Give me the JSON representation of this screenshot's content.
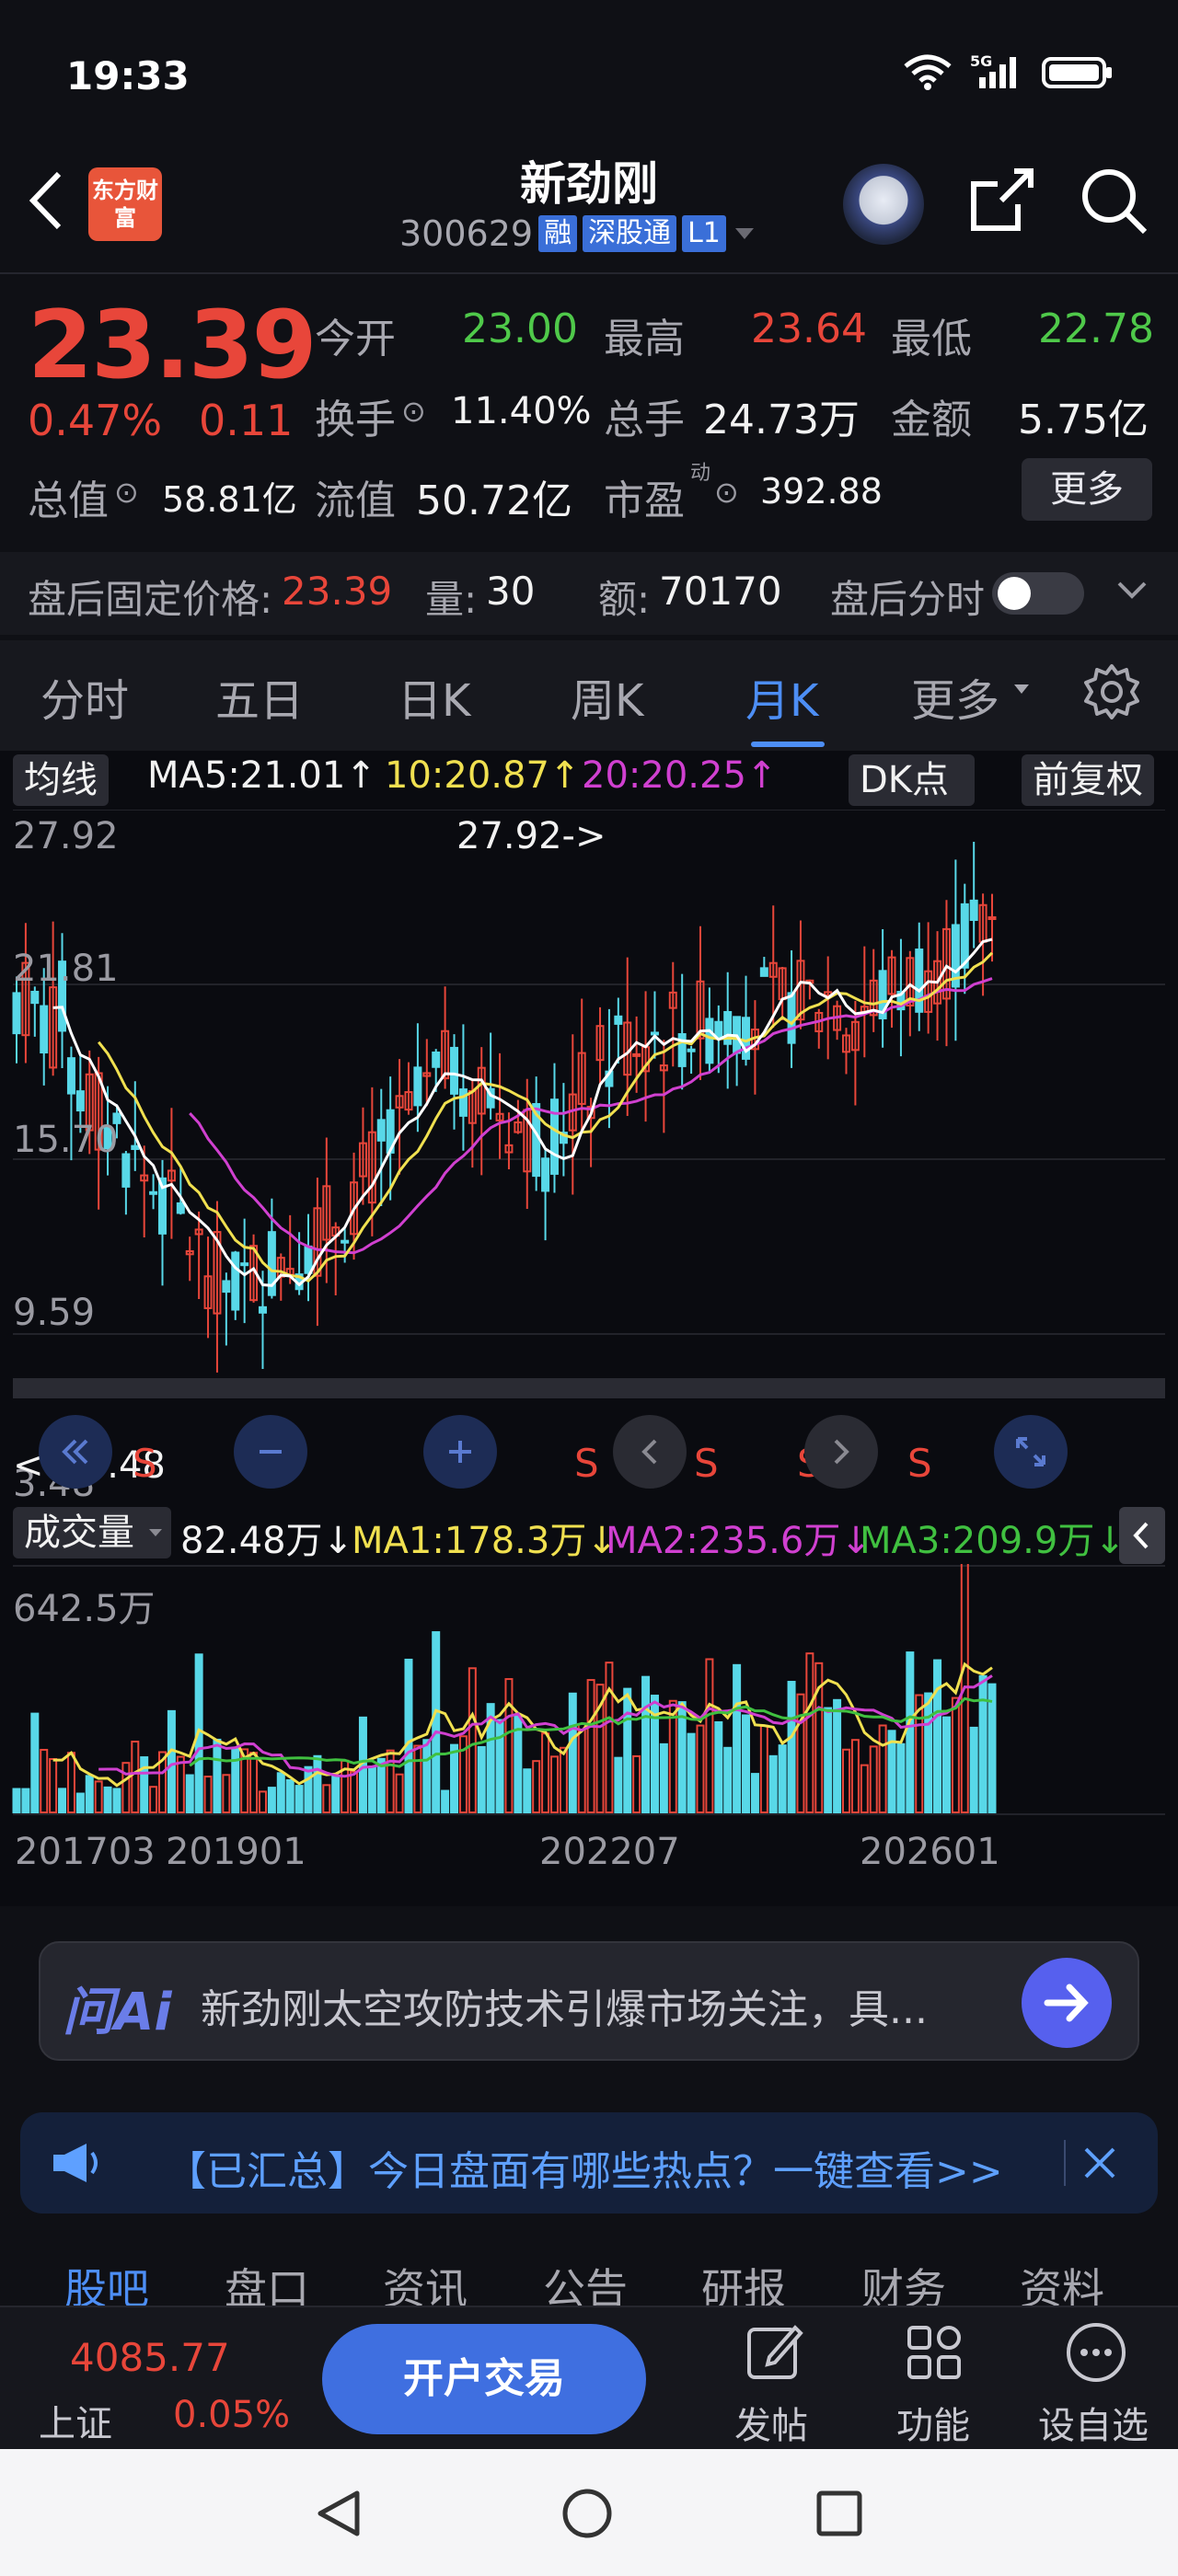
{
  "status": {
    "time": "19:33",
    "network": "5G"
  },
  "header": {
    "title": "新劲刚",
    "code": "300629",
    "tags": [
      "融",
      "深股通",
      "L1"
    ],
    "logo": "东方财富"
  },
  "quote": {
    "price": "23.39",
    "change_pct": "0.47%",
    "change": "0.11",
    "open_label": "今开",
    "open": "23.00",
    "high_label": "最高",
    "high": "23.64",
    "low_label": "最低",
    "low": "22.78",
    "turnover_label": "换手",
    "turnover": "11.40%",
    "volume_label": "总手",
    "volume": "24.73万",
    "amount_label": "金额",
    "amount": "5.75亿",
    "mcap_label": "总值",
    "mcap": "58.81亿",
    "float_label": "流值",
    "float": "50.72亿",
    "pe_label": "市盈",
    "pe_sup": "动",
    "pe": "392.88",
    "more": "更多"
  },
  "after_hours": {
    "price_label": "盘后固定价格:",
    "price": "23.39",
    "vol_label": "量:",
    "vol": "30",
    "amt_label": "额:",
    "amt": "70170",
    "tick_label": "盘后分时"
  },
  "tabs": [
    "分时",
    "五日",
    "日K",
    "周K",
    "月K",
    "更多"
  ],
  "active_tab": "月K",
  "kline": {
    "ma_btn": "均线",
    "ma5": "MA5:21.01↑",
    "ma10": "10:20.87↑",
    "ma20": "20:20.25↑",
    "dk_btn": "DK点",
    "fq_btn": "前复权",
    "y_top": "27.92",
    "y2": "21.81",
    "y3": "15.70",
    "y4": "9.59",
    "y_bottom": "3.48",
    "max_label": "27.92->",
    "min_label": "<---3.48",
    "s_marker": "S",
    "colors": {
      "up": "#e8463a",
      "down": "#58d8e8",
      "ma5": "#ffffff",
      "ma10": "#f0e050",
      "ma20": "#d040d0",
      "ma3": "#40c040"
    }
  },
  "volume": {
    "btn": "成交量",
    "value": "82.48万↓",
    "ma1": "MA1:178.3万↓",
    "ma2": "MA2:235.6万↓",
    "ma3": "MA3:209.9万↓",
    "y_top": "642.5万",
    "x_labels": [
      "201703",
      "201901",
      "202207",
      "202601"
    ]
  },
  "ai": {
    "logo": "问Ai",
    "text": "新劲刚太空攻防技术引爆市场关注，具..."
  },
  "notice": {
    "text": "【已汇总】今日盘面有哪些热点？一键查看>>"
  },
  "subtabs": [
    "股吧",
    "盘口",
    "资讯",
    "公告",
    "研报",
    "财务",
    "资料"
  ],
  "index": {
    "value": "4085.77",
    "name": "上证",
    "pct": "0.05%"
  },
  "bottom": {
    "trade": "开户交易",
    "post": "发帖",
    "func": "功能",
    "watch": "设自选"
  }
}
